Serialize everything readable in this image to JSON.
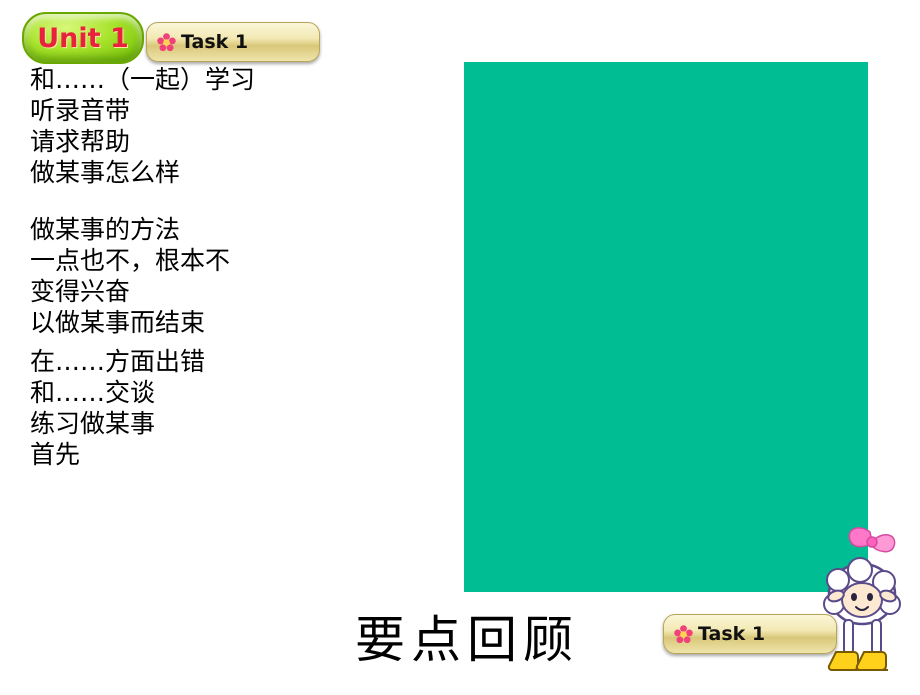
{
  "slide": {
    "unit_badge": {
      "label": "Unit 1",
      "color": "#e8213d",
      "bg_color": "#9ede1f"
    },
    "task_pill_top": {
      "label": "Task 1",
      "icon": "flower-icon"
    },
    "task_pill_bottom": {
      "label": "Task 1",
      "icon": "flower-icon"
    },
    "phrase_lines": [
      "和……（一起）学习",
      "听录音带",
      "请求帮助",
      "做某事怎么样",
      "做某事的方法",
      "一点也不，根本不",
      "变得兴奋",
      "以做某事而结束",
      "在……方面出错",
      "和……交谈",
      "练习做某事",
      " 首先"
    ],
    "green_panel": {
      "color": "#00BD93"
    },
    "bottom_heading": "要点回顾",
    "mascot": {
      "name": "sheep-mascot"
    }
  }
}
